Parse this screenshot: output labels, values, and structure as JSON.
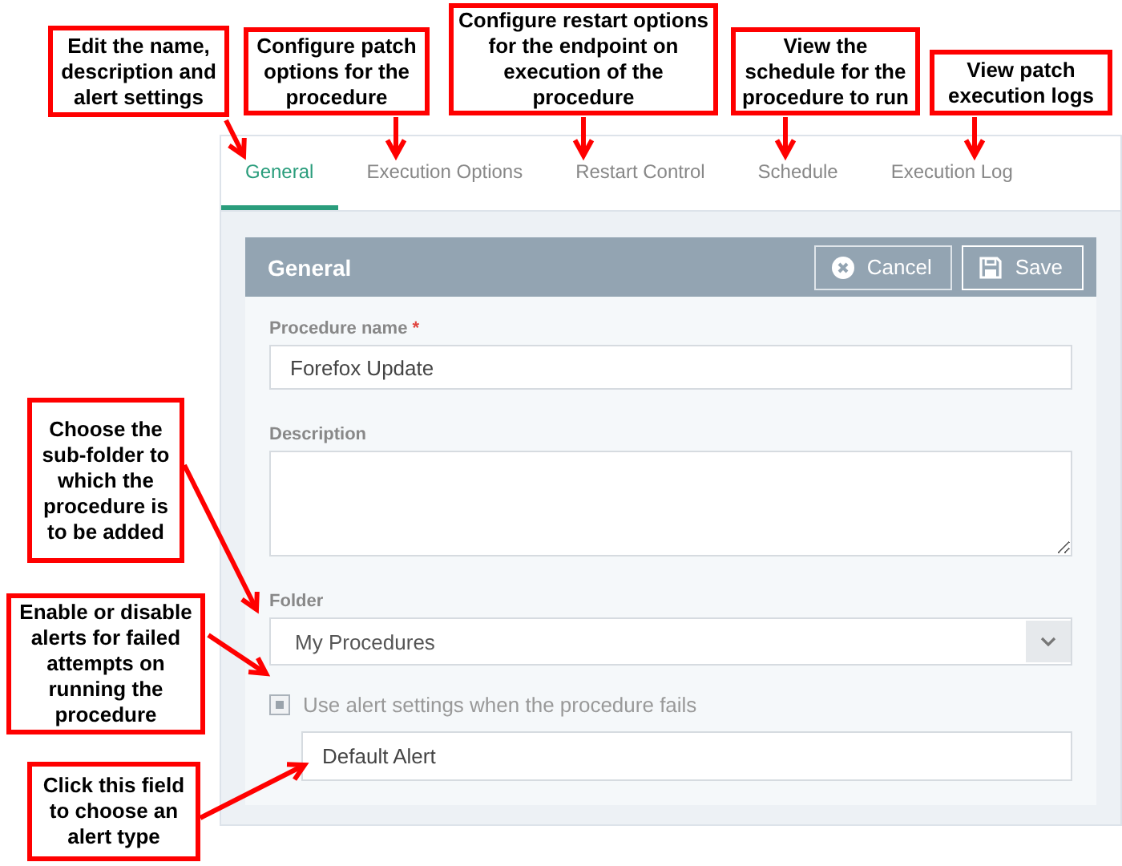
{
  "tabs": [
    {
      "label": "General",
      "selected": true
    },
    {
      "label": "Execution Options",
      "selected": false
    },
    {
      "label": "Restart Control",
      "selected": false
    },
    {
      "label": "Schedule",
      "selected": false
    },
    {
      "label": "Execution Log",
      "selected": false
    }
  ],
  "panel": {
    "title": "General",
    "buttons": [
      {
        "kind": "cancel",
        "label": "Cancel"
      },
      {
        "kind": "save",
        "label": "Save"
      }
    ]
  },
  "form": {
    "name_label": "Procedure name",
    "required_mark": "*",
    "name_value": "Forefox Update",
    "description_label": "Description",
    "folder_label": "Folder",
    "folder_value": "My Procedures",
    "alert_label": "Use alert settings when the procedure fails",
    "alert_checked": true,
    "alert_value": "Default Alert"
  },
  "callouts": [
    {
      "text": "Edit the name, description and alert settings"
    },
    {
      "text": "Configure patch options for the procedure"
    },
    {
      "text": "Configure restart options for the endpoint on execution of the procedure"
    },
    {
      "text": "View the schedule for the procedure to run"
    },
    {
      "text": "View patch execution logs"
    },
    {
      "text": "Choose the sub-folder to which the procedure is to be added"
    },
    {
      "text": "Enable or disable alerts for failed attempts on running the procedure"
    },
    {
      "text": "Click this field to choose an alert type"
    }
  ]
}
